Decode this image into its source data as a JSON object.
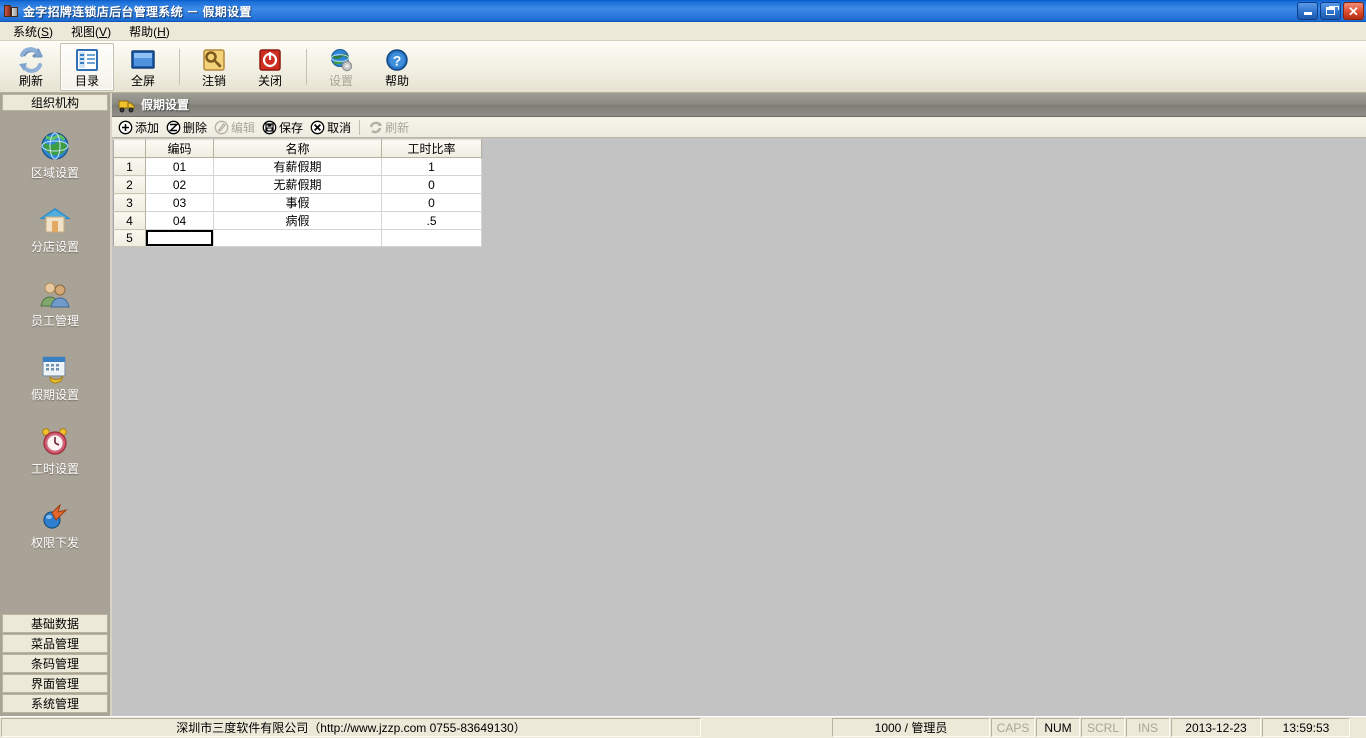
{
  "window": {
    "title": "金字招牌连锁店后台管理系统  －  假期设置",
    "icon": "server-icon",
    "minimize_label": "最小化",
    "restore_label": "还原",
    "close_label": "关闭"
  },
  "menubar": {
    "items": [
      {
        "label": "系统",
        "accel": "S"
      },
      {
        "label": "视图",
        "accel": "V"
      },
      {
        "label": "帮助",
        "accel": "H"
      }
    ]
  },
  "toolbar": {
    "items": [
      {
        "label": "刷新",
        "icon": "refresh-icon",
        "selected": false,
        "disabled": false
      },
      {
        "label": "目录",
        "icon": "catalog-icon",
        "selected": true,
        "disabled": false
      },
      {
        "label": "全屏",
        "icon": "fullscreen-icon",
        "selected": false,
        "disabled": false
      },
      {
        "label": "注销",
        "icon": "key-icon",
        "selected": false,
        "disabled": false
      },
      {
        "label": "关闭",
        "icon": "power-icon",
        "selected": false,
        "disabled": false
      },
      {
        "label": "设置",
        "icon": "globe-gear-icon",
        "selected": false,
        "disabled": true
      },
      {
        "label": "帮助",
        "icon": "help-icon",
        "selected": false,
        "disabled": false
      }
    ]
  },
  "sidebar": {
    "header": "组织机构",
    "items": [
      {
        "label": "区域设置",
        "icon": "globe-icon"
      },
      {
        "label": "分店设置",
        "icon": "house-icon"
      },
      {
        "label": "员工管理",
        "icon": "users-icon"
      },
      {
        "label": "假期设置",
        "icon": "calendar-icon"
      },
      {
        "label": "工时设置",
        "icon": "alarm-clock-icon"
      },
      {
        "label": "权限下发",
        "icon": "permission-send-icon"
      }
    ],
    "groups": [
      {
        "label": "基础数据"
      },
      {
        "label": "菜品管理"
      },
      {
        "label": "条码管理"
      },
      {
        "label": "界面管理"
      },
      {
        "label": "系统管理"
      }
    ]
  },
  "panel": {
    "title": "假期设置",
    "icon": "truck-icon",
    "actions": [
      {
        "label": "添加",
        "icon": "add-icon",
        "disabled": false
      },
      {
        "label": "删除",
        "icon": "delete-icon",
        "disabled": false
      },
      {
        "label": "编辑",
        "icon": "edit-icon",
        "disabled": true
      },
      {
        "label": "保存",
        "icon": "save-icon",
        "disabled": false
      },
      {
        "label": "取消",
        "icon": "cancel-icon",
        "disabled": false
      },
      {
        "label": "刷新",
        "icon": "refresh-icon",
        "disabled": true
      }
    ]
  },
  "grid": {
    "columns": [
      "",
      "编码",
      "名称",
      "工时比率"
    ],
    "rows": [
      {
        "num": "1",
        "code": "01",
        "name": "有薪假期",
        "ratio": "1"
      },
      {
        "num": "2",
        "code": "02",
        "name": "无薪假期",
        "ratio": "0"
      },
      {
        "num": "3",
        "code": "03",
        "name": "事假",
        "ratio": "0"
      },
      {
        "num": "4",
        "code": "04",
        "name": "病假",
        "ratio": ".5"
      }
    ],
    "edit_row": {
      "num": "5",
      "code": "",
      "name": "",
      "ratio": "",
      "active_cell": "code"
    }
  },
  "statusbar": {
    "copyright": "深圳市三度软件有限公司（http://www.jzzp.com  0755-83649130）",
    "user": "1000 / 管理员",
    "keys": [
      {
        "label": "CAPS",
        "on": false
      },
      {
        "label": "NUM",
        "on": true
      },
      {
        "label": "SCRL",
        "on": false
      },
      {
        "label": "INS",
        "on": false
      }
    ],
    "date": "2013-12-23",
    "time": "13:59:53"
  },
  "colors": {
    "titlebar_blue": "#1e6ed6",
    "beige": "#ece9d8",
    "sidebar_grey": "#a9a296",
    "content_grey": "#c3c3c3",
    "panel_head_grey": "#8b8b83",
    "close_red": "#dc4b2c"
  }
}
